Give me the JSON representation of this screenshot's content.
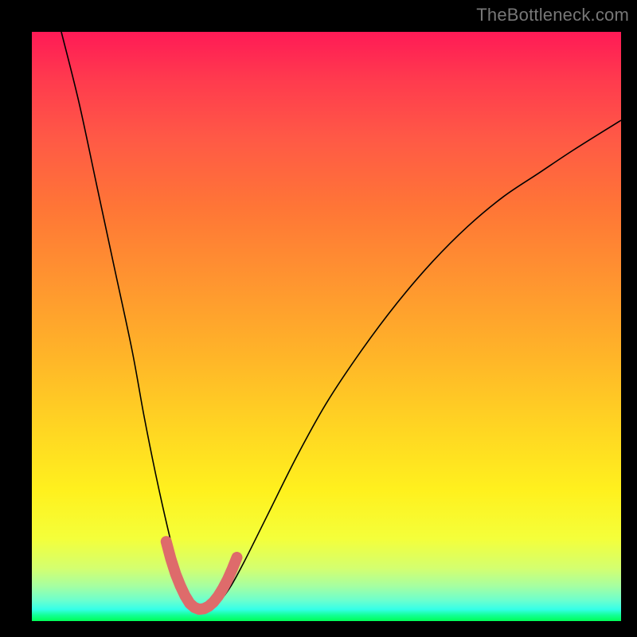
{
  "watermark": "TheBottleneck.com",
  "chart_data": {
    "type": "line",
    "title": "",
    "xlabel": "",
    "ylabel": "",
    "xlim": [
      0,
      100
    ],
    "ylim": [
      0,
      100
    ],
    "grid": false,
    "legend": false,
    "series": [
      {
        "name": "bottleneck-curve",
        "x": [
          5,
          8,
          11,
          14,
          17,
          19,
          21,
          23,
          24.5,
          26,
          27.5,
          29,
          31,
          33.5,
          36,
          40,
          45,
          50,
          56,
          62,
          68,
          74,
          80,
          86,
          92,
          100
        ],
        "y": [
          100,
          88,
          74,
          60,
          46,
          35,
          25,
          16,
          10,
          5.5,
          2.5,
          2,
          2.5,
          5.5,
          10,
          18,
          28,
          37,
          46,
          54,
          61,
          67,
          72,
          76,
          80,
          85
        ]
      }
    ],
    "markers": {
      "name": "highlighted-valley",
      "x": [
        22.8,
        23.6,
        24.4,
        25.2,
        26.0,
        26.8,
        27.6,
        28.4,
        29.2,
        30.0,
        30.8,
        31.6,
        32.4,
        33.2,
        34.0,
        34.8
      ],
      "y": [
        13.5,
        10.5,
        8.0,
        6.0,
        4.3,
        3.0,
        2.3,
        2.0,
        2.1,
        2.5,
        3.2,
        4.2,
        5.5,
        7.0,
        8.8,
        10.8
      ]
    },
    "colors": {
      "background_top": "#ff1a56",
      "background_bottom": "#00ff57",
      "curve": "#000000",
      "marker": "#de6b6b",
      "frame": "#000000"
    }
  }
}
